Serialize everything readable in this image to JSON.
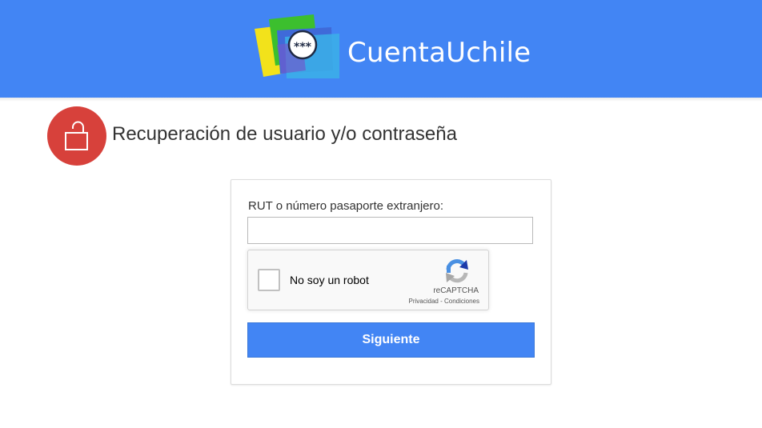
{
  "header": {
    "brand": "CuentaUchile",
    "logo_icon": "password-cards-logo",
    "logo_text": "***",
    "background": "#4285f4"
  },
  "page": {
    "title": "Recuperación de usuario y/o contraseña",
    "title_icon": "unlock-icon",
    "title_icon_color": "#d7413b"
  },
  "form": {
    "rut_label": "RUT o número pasaporte extranjero:",
    "rut_value": "",
    "rut_placeholder": "",
    "recaptcha": {
      "label": "No soy un robot",
      "brand": "reCAPTCHA",
      "privacy_link": "Privacidad",
      "separator": " - ",
      "terms_link": "Condiciones"
    },
    "submit_label": "Siguiente",
    "accent": "#4285f4"
  }
}
